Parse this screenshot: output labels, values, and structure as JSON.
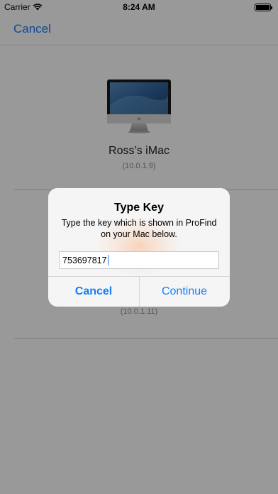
{
  "status_bar": {
    "carrier": "Carrier",
    "time": "8:24 AM",
    "wifi_icon": "wifi-icon",
    "battery_icon": "battery-icon"
  },
  "nav": {
    "cancel_label": "Cancel"
  },
  "devices": [
    {
      "name": "Ross’s iMac",
      "ip": "(10.0.1.9)",
      "icon": "imac-icon"
    },
    {
      "ip": "(10.0.1.11)"
    }
  ],
  "alert": {
    "title": "Type Key",
    "message": "Type the key which is shown in ProFind on your Mac below.",
    "input_value": "753697817",
    "cancel_label": "Cancel",
    "continue_label": "Continue"
  },
  "colors": {
    "accent": "#147efb",
    "overlay": "rgba(0,0,0,0.40)"
  }
}
